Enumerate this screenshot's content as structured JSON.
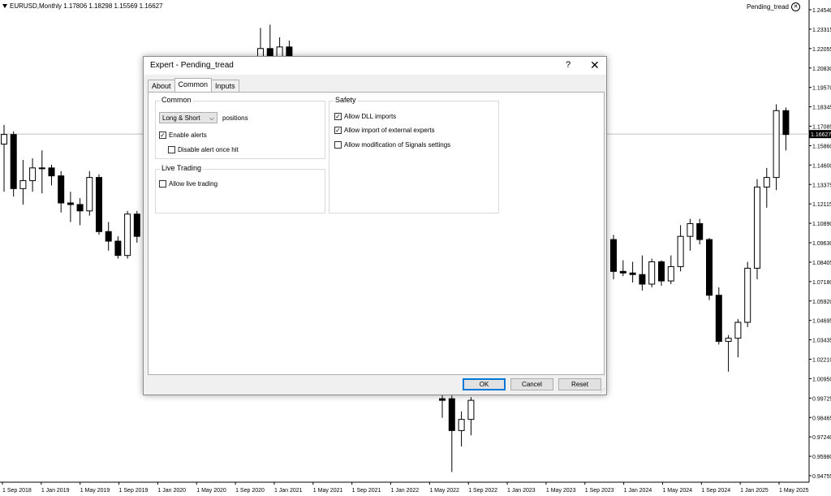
{
  "chart": {
    "symbol_label": "EURUSD,Monthly  1.17806 1.18298 1.15569 1.16627",
    "ea_label": "Pending_tread",
    "ea_close_icon": "close-circle-icon",
    "current_price": "1.16627",
    "price_levels": [
      "1.24540",
      "1.23315",
      "1.22055",
      "1.20830",
      "1.19570",
      "1.18345",
      "1.17085",
      "1.15860",
      "1.14600",
      "1.13375",
      "1.12115",
      "1.10890",
      "1.09630",
      "1.08405",
      "1.07180",
      "1.05920",
      "1.04695",
      "1.03435",
      "1.02210",
      "1.00950",
      "0.99725",
      "0.98465",
      "0.97240",
      "0.95980",
      "0.94755"
    ],
    "date_labels": [
      "1 Sep 2018",
      "1 Jan 2019",
      "1 May 2019",
      "1 Sep 2019",
      "1 Jan 2020",
      "1 May 2020",
      "1 Sep 2020",
      "1 Jan 2021",
      "1 May 2021",
      "1 Sep 2021",
      "1 Jan 2022",
      "1 May 2022",
      "1 Sep 2022",
      "1 Jan 2023",
      "1 May 2023",
      "1 Sep 2023",
      "1 Jan 2024",
      "1 May 2024",
      "1 Sep 2024",
      "1 Jan 2025",
      "1 May 2025"
    ],
    "colors": {
      "bull_fill": "#ffffff",
      "bear_fill": "#000000",
      "wick": "#000000",
      "grid": "#c0c0c0"
    }
  },
  "chart_data": {
    "type": "candlestick",
    "ylim": [
      0.94755,
      1.2454
    ],
    "candles": [
      {
        "o": 1.16,
        "h": 1.172,
        "l": 1.13,
        "c": 1.166
      },
      {
        "o": 1.166,
        "h": 1.168,
        "l": 1.127,
        "c": 1.132
      },
      {
        "o": 1.132,
        "h": 1.15,
        "l": 1.122,
        "c": 1.137
      },
      {
        "o": 1.137,
        "h": 1.151,
        "l": 1.13,
        "c": 1.145
      },
      {
        "o": 1.145,
        "h": 1.156,
        "l": 1.129,
        "c": 1.145
      },
      {
        "o": 1.145,
        "h": 1.147,
        "l": 1.134,
        "c": 1.14
      },
      {
        "o": 1.14,
        "h": 1.143,
        "l": 1.117,
        "c": 1.123
      },
      {
        "o": 1.123,
        "h": 1.13,
        "l": 1.111,
        "c": 1.122
      },
      {
        "o": 1.122,
        "h": 1.126,
        "l": 1.109,
        "c": 1.118
      },
      {
        "o": 1.118,
        "h": 1.143,
        "l": 1.115,
        "c": 1.139
      },
      {
        "o": 1.139,
        "h": 1.141,
        "l": 1.103,
        "c": 1.105
      },
      {
        "o": 1.105,
        "h": 1.111,
        "l": 1.093,
        "c": 1.099
      },
      {
        "o": 1.099,
        "h": 1.102,
        "l": 1.088,
        "c": 1.09
      },
      {
        "o": 1.09,
        "h": 1.118,
        "l": 1.088,
        "c": 1.116
      },
      {
        "o": 1.116,
        "h": 1.118,
        "l": 1.098,
        "c": 1.102
      }
    ],
    "candles_right": [
      {
        "o": 1.1,
        "h": 1.103,
        "l": 1.075,
        "c": 1.08
      },
      {
        "o": 1.08,
        "h": 1.087,
        "l": 1.077,
        "c": 1.079
      },
      {
        "o": 1.079,
        "h": 1.086,
        "l": 1.073,
        "c": 1.078
      },
      {
        "o": 1.078,
        "h": 1.09,
        "l": 1.068,
        "c": 1.072
      },
      {
        "o": 1.072,
        "h": 1.088,
        "l": 1.07,
        "c": 1.086
      },
      {
        "o": 1.086,
        "h": 1.087,
        "l": 1.071,
        "c": 1.074
      },
      {
        "o": 1.074,
        "h": 1.09,
        "l": 1.072,
        "c": 1.083
      },
      {
        "o": 1.083,
        "h": 1.109,
        "l": 1.08,
        "c": 1.102
      },
      {
        "o": 1.102,
        "h": 1.113,
        "l": 1.093,
        "c": 1.11
      },
      {
        "o": 1.11,
        "h": 1.113,
        "l": 1.097,
        "c": 1.1
      },
      {
        "o": 1.1,
        "h": 1.101,
        "l": 1.062,
        "c": 1.065
      },
      {
        "o": 1.065,
        "h": 1.07,
        "l": 1.034,
        "c": 1.036
      },
      {
        "o": 1.036,
        "h": 1.04,
        "l": 1.017,
        "c": 1.038
      },
      {
        "o": 1.038,
        "h": 1.05,
        "l": 1.026,
        "c": 1.048
      },
      {
        "o": 1.048,
        "h": 1.086,
        "l": 1.045,
        "c": 1.082
      },
      {
        "o": 1.082,
        "h": 1.138,
        "l": 1.075,
        "c": 1.133
      },
      {
        "o": 1.133,
        "h": 1.145,
        "l": 1.12,
        "c": 1.139
      },
      {
        "o": 1.139,
        "h": 1.185,
        "l": 1.131,
        "c": 1.181
      },
      {
        "o": 1.181,
        "h": 1.183,
        "l": 1.156,
        "c": 1.166
      }
    ],
    "candles_top": [
      {
        "o": 1.212,
        "h": 1.233,
        "l": 1.2,
        "c": 1.22
      },
      {
        "o": 1.22,
        "h": 1.235,
        "l": 1.203,
        "c": 1.214
      },
      {
        "o": 1.213,
        "h": 1.227,
        "l": 1.204,
        "c": 1.221
      },
      {
        "o": 1.221,
        "h": 1.225,
        "l": 1.203,
        "c": 1.215
      }
    ],
    "candles_bottom": [
      {
        "o": 1.0,
        "h": 1.005,
        "l": 0.988,
        "c": 0.999
      },
      {
        "o": 1.0,
        "h": 1.002,
        "l": 0.954,
        "c": 0.98
      },
      {
        "o": 0.98,
        "h": 0.992,
        "l": 0.97,
        "c": 0.987
      },
      {
        "o": 0.987,
        "h": 1.001,
        "l": 0.977,
        "c": 0.999
      }
    ]
  },
  "dialog": {
    "title": "Expert - Pending_tread",
    "help_label": "?",
    "close_label": "✕",
    "tabs": [
      {
        "label": "About"
      },
      {
        "label": "Common"
      },
      {
        "label": "Inputs"
      }
    ],
    "common_group": {
      "title": "Common",
      "positions_value": "Long & Short",
      "positions_suffix": "positions",
      "enable_alerts": "Enable alerts",
      "disable_alert_once_hit": "Disable alert once hit"
    },
    "live_group": {
      "title": "Live Trading",
      "allow_live_trading": "Allow live trading"
    },
    "safety_group": {
      "title": "Safety",
      "allow_dll": "Allow DLL imports",
      "allow_external": "Allow import of external experts",
      "allow_signals": "Allow modification of Signals settings"
    },
    "check_mark": "✓",
    "ok_label": "OK",
    "cancel_label": "Cancel",
    "reset_label": "Reset"
  }
}
